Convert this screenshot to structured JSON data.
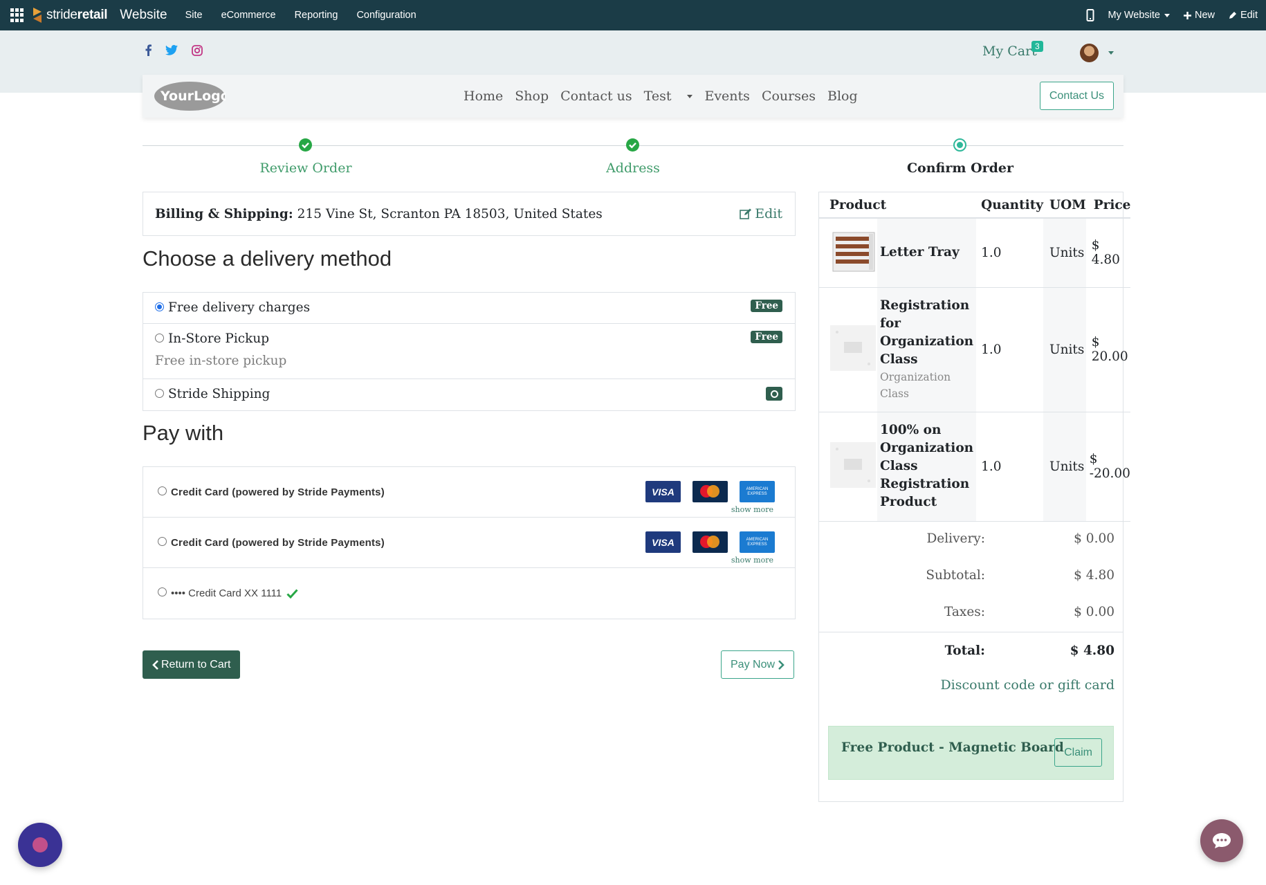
{
  "admin_bar": {
    "brand_light": "stride",
    "brand_bold": "retail",
    "app_name": "Website",
    "menu": [
      "Site",
      "eCommerce",
      "Reporting",
      "Configuration"
    ],
    "website_selector": "My Website",
    "new_label": "New",
    "edit_label": "Edit"
  },
  "header": {
    "cart_label": "My Cart",
    "cart_count": "3",
    "social_icons": [
      "facebook-icon",
      "twitter-icon",
      "instagram-icon"
    ]
  },
  "navbar": {
    "logo_text": "YourLogo",
    "links": [
      "Home",
      "Shop",
      "Contact us",
      "Test",
      "Events",
      "Courses",
      "Blog"
    ],
    "contact_button": "Contact Us"
  },
  "steps": [
    {
      "label": "Review Order",
      "state": "done"
    },
    {
      "label": "Address",
      "state": "done"
    },
    {
      "label": "Confirm Order",
      "state": "active"
    }
  ],
  "billing": {
    "label": "Billing & Shipping:",
    "address": "215 Vine St, Scranton PA 18503, United States",
    "edit_label": "Edit"
  },
  "delivery": {
    "title": "Choose a delivery method",
    "methods": [
      {
        "name": "Free delivery charges",
        "badge": "Free",
        "selected": true,
        "description": ""
      },
      {
        "name": "In-Store Pickup",
        "badge": "Free",
        "selected": false,
        "description": "Free in-store pickup"
      },
      {
        "name": "Stride Shipping",
        "badge": "",
        "selected": false,
        "description": ""
      }
    ]
  },
  "payment": {
    "title": "Pay with",
    "options": [
      {
        "label": "Credit Card (powered by Stride Payments)",
        "show_more": "show more"
      },
      {
        "label": "Credit Card (powered by Stride Payments)",
        "show_more": "show more"
      },
      {
        "label": "•••• Credit Card XX 1111"
      }
    ],
    "card_brands": [
      "VISA",
      "MasterCard",
      "AMERICAN EXPRESS"
    ]
  },
  "buttons": {
    "return_to_cart": "Return to Cart",
    "pay_now": "Pay Now"
  },
  "summary": {
    "headers": [
      "Product",
      "Quantity",
      "UOM",
      "Price"
    ],
    "rows": [
      {
        "name": "Letter Tray",
        "sub": "",
        "qty": "1.0",
        "uom": "Units",
        "price": "$ 4.80"
      },
      {
        "name": "Registration for Organization Class",
        "sub": "Organization Class",
        "qty": "1.0",
        "uom": "Units",
        "price": "$ 20.00"
      },
      {
        "name": "100% on Organization Class Registration Product",
        "sub": "",
        "qty": "1.0",
        "uom": "Units",
        "price": "$ -20.00"
      }
    ],
    "delivery_label": "Delivery:",
    "delivery_value": "$ 0.00",
    "subtotal_label": "Subtotal:",
    "subtotal_value": "$ 4.80",
    "taxes_label": "Taxes:",
    "taxes_value": "$ 0.00",
    "total_label": "Total:",
    "total_value": "$ 4.80",
    "discount_link": "Discount code or gift card",
    "promo_text": "Free Product - Magnetic Board",
    "claim_label": "Claim"
  },
  "colors": {
    "admin_bar": "#1b3c47",
    "accent": "#3a7a6b",
    "badge": "#2f5e4e",
    "success": "#27a745",
    "promo_bg": "#d4edda"
  }
}
